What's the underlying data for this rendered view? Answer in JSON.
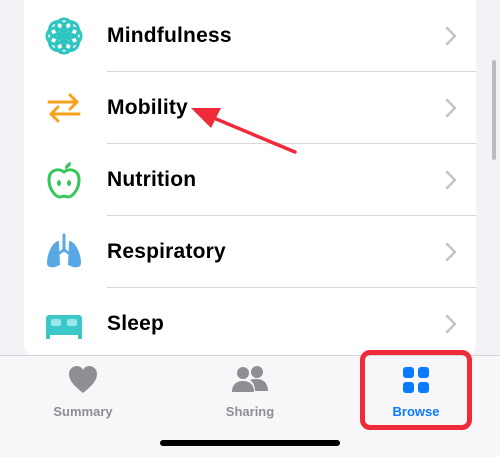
{
  "list": {
    "items": [
      {
        "label": "Mindfulness",
        "icon": "mindfulness-icon",
        "color": "#2ec5c0"
      },
      {
        "label": "Mobility",
        "icon": "mobility-arrows-icon",
        "color": "#f6a11a"
      },
      {
        "label": "Nutrition",
        "icon": "apple-icon",
        "color": "#34c759"
      },
      {
        "label": "Respiratory",
        "icon": "lungs-icon",
        "color": "#5aa9e6"
      },
      {
        "label": "Sleep",
        "icon": "bed-icon",
        "color": "#3cc8c8"
      }
    ]
  },
  "tabbar": {
    "tabs": [
      {
        "label": "Summary",
        "icon": "heart-icon",
        "active": false
      },
      {
        "label": "Sharing",
        "icon": "people-icon",
        "active": false
      },
      {
        "label": "Browse",
        "icon": "grid-icon",
        "active": true
      }
    ]
  },
  "colors": {
    "accent": "#0a7aff",
    "annotation": "#ef2b3a"
  }
}
